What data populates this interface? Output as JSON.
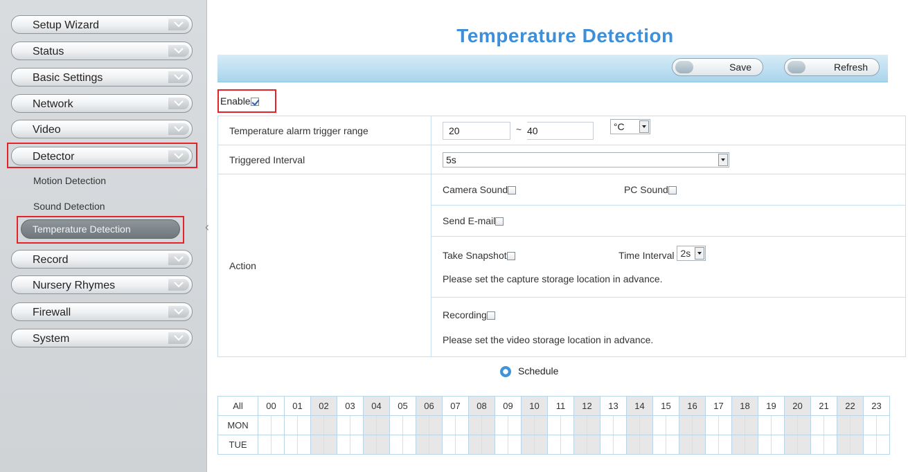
{
  "sidebar": {
    "menu": [
      {
        "label": "Setup Wizard"
      },
      {
        "label": "Status"
      },
      {
        "label": "Basic Settings"
      },
      {
        "label": "Network"
      },
      {
        "label": "Video"
      },
      {
        "label": "Detector"
      },
      {
        "label": "Record"
      },
      {
        "label": "Nursery Rhymes"
      },
      {
        "label": "Firewall"
      },
      {
        "label": "System"
      }
    ],
    "detector_sub": [
      {
        "label": "Motion Detection"
      },
      {
        "label": "Sound Detection"
      },
      {
        "label": "Temperature Detection"
      }
    ]
  },
  "main": {
    "title": "Temperature Detection",
    "toolbar": {
      "save_label": "Save",
      "refresh_label": "Refresh"
    },
    "enable_label": "Enable",
    "enabled": true,
    "temp_range": {
      "label": "Temperature alarm trigger range",
      "min": "20",
      "sep": "~",
      "max": "40",
      "unit": "°C"
    },
    "triggered_interval": {
      "label": "Triggered Interval",
      "value": "5s"
    },
    "action": {
      "label": "Action",
      "camera_sound": "Camera Sound",
      "pc_sound": "PC Sound",
      "send_email": "Send E-mail",
      "take_snapshot": "Take Snapshot",
      "time_interval_label": "Time Interval",
      "time_interval_value": "2s",
      "capture_note": "Please set the capture storage location in advance.",
      "recording": "Recording",
      "video_note": "Please set the video storage location in advance."
    },
    "schedule": {
      "label": "Schedule",
      "all": "All",
      "hours": [
        "00",
        "01",
        "02",
        "03",
        "04",
        "05",
        "06",
        "07",
        "08",
        "09",
        "10",
        "11",
        "12",
        "13",
        "14",
        "15",
        "16",
        "17",
        "18",
        "19",
        "20",
        "21",
        "22",
        "23"
      ],
      "days": [
        "MON",
        "TUE"
      ]
    }
  },
  "colors": {
    "accent": "#3c8fd8",
    "highlight": "#e3222a",
    "toolbar": "#a9d4ec"
  }
}
